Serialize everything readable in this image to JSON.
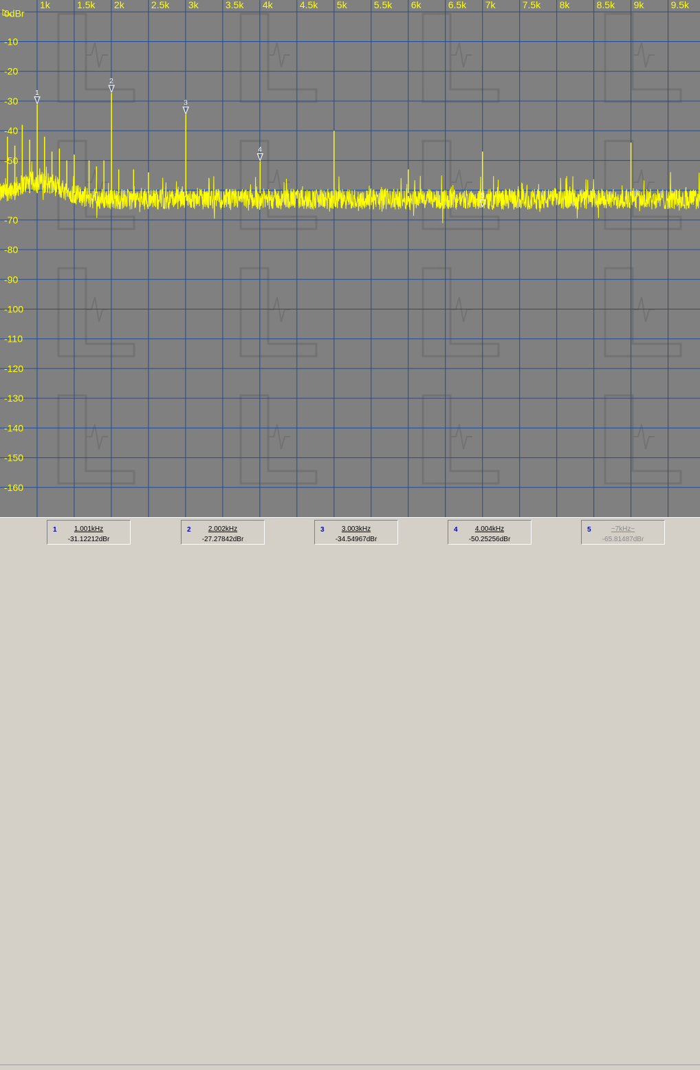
{
  "chart_data": {
    "type": "line",
    "x_unit": "Hz",
    "xlim": [
      500,
      9930
    ],
    "ylim": [
      -170,
      4
    ],
    "y_unit_label": "0dBr",
    "x_ticks": [
      {
        "value": 1000,
        "label": "1k"
      },
      {
        "value": 1500,
        "label": "1.5k"
      },
      {
        "value": 2000,
        "label": "2k"
      },
      {
        "value": 2500,
        "label": "2.5k"
      },
      {
        "value": 3000,
        "label": "3k"
      },
      {
        "value": 3500,
        "label": "3.5k"
      },
      {
        "value": 4000,
        "label": "4k"
      },
      {
        "value": 4500,
        "label": "4.5k"
      },
      {
        "value": 5000,
        "label": "5k"
      },
      {
        "value": 5500,
        "label": "5.5k"
      },
      {
        "value": 6000,
        "label": "6k"
      },
      {
        "value": 6500,
        "label": "6.5k"
      },
      {
        "value": 7000,
        "label": "7k"
      },
      {
        "value": 7500,
        "label": "7.5k"
      },
      {
        "value": 8000,
        "label": "8k"
      },
      {
        "value": 8500,
        "label": "8.5k"
      },
      {
        "value": 9000,
        "label": "9k"
      },
      {
        "value": 9500,
        "label": "9.5k"
      }
    ],
    "y_ticks": [
      {
        "value": -10,
        "label": "-10"
      },
      {
        "value": -20,
        "label": "-20"
      },
      {
        "value": -30,
        "label": "-30"
      },
      {
        "value": -40,
        "label": "-40"
      },
      {
        "value": -50,
        "label": "-50"
      },
      {
        "value": -60,
        "label": "-60"
      },
      {
        "value": -70,
        "label": "-70"
      },
      {
        "value": -80,
        "label": "-80"
      },
      {
        "value": -90,
        "label": "-90"
      },
      {
        "value": -100,
        "label": "-100"
      },
      {
        "value": -110,
        "label": "-110"
      },
      {
        "value": -120,
        "label": "-120"
      },
      {
        "value": -130,
        "label": "-130"
      },
      {
        "value": -140,
        "label": "-140"
      },
      {
        "value": -150,
        "label": "-150"
      },
      {
        "value": -160,
        "label": "-160"
      }
    ],
    "grid": true,
    "noise_floor_db": -63,
    "peaks": [
      {
        "freq": 1001,
        "db": -31.1
      },
      {
        "freq": 2002,
        "db": -27.3
      },
      {
        "freq": 3003,
        "db": -34.5
      },
      {
        "freq": 4004,
        "db": -50.3
      },
      {
        "freq": 5000,
        "db": -40
      },
      {
        "freq": 6000,
        "db": -53
      },
      {
        "freq": 7000,
        "db": -47
      },
      {
        "freq": 9000,
        "db": -44
      },
      {
        "freq": 600,
        "db": -42
      },
      {
        "freq": 700,
        "db": -45
      },
      {
        "freq": 800,
        "db": -38
      },
      {
        "freq": 900,
        "db": -43
      },
      {
        "freq": 1100,
        "db": -42
      },
      {
        "freq": 1200,
        "db": -47
      },
      {
        "freq": 1300,
        "db": -46
      },
      {
        "freq": 1400,
        "db": -50
      },
      {
        "freq": 1500,
        "db": -48
      },
      {
        "freq": 1700,
        "db": -50
      },
      {
        "freq": 1800,
        "db": -52
      },
      {
        "freq": 1900,
        "db": -50
      },
      {
        "freq": 2100,
        "db": -53
      },
      {
        "freq": 2300,
        "db": -53
      },
      {
        "freq": 2500,
        "db": -54
      }
    ],
    "markers": [
      {
        "index": "1",
        "freq": 1001,
        "db": -31.12
      },
      {
        "index": "2",
        "freq": 2002,
        "db": -27.28
      },
      {
        "index": "3",
        "freq": 3003,
        "db": -34.55
      },
      {
        "index": "4",
        "freq": 4004,
        "db": -50.25
      },
      {
        "index": "5",
        "freq": 7000,
        "db": -65.81
      }
    ],
    "colors": {
      "background": "#808080",
      "grid": "#1f4c9a",
      "trace": "#ffff00",
      "axis_text": "#ffff00",
      "marker": "#ffffff"
    }
  },
  "marker_panel": [
    {
      "index": "1",
      "freq": "1.001kHz",
      "level": "-31.12212dBr",
      "enabled": true
    },
    {
      "index": "2",
      "freq": "2.002kHz",
      "level": "-27.27842dBr",
      "enabled": true
    },
    {
      "index": "3",
      "freq": "3.003kHz",
      "level": "-34.54967dBr",
      "enabled": true
    },
    {
      "index": "4",
      "freq": "4.004kHz",
      "level": "-50.25256dBr",
      "enabled": true
    },
    {
      "index": "5",
      "freq": "~7kHz~",
      "level": "-65.81487dBr",
      "enabled": false
    }
  ]
}
